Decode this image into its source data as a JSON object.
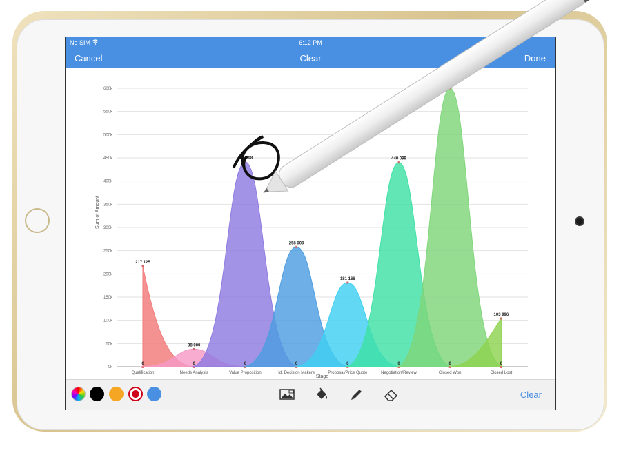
{
  "status": {
    "carrier": "No SIM",
    "time": "6:12 PM"
  },
  "nav": {
    "left_label": "Cancel",
    "center_label": "Clear",
    "right_label": "Done"
  },
  "toolbar": {
    "colors": [
      "#ff0000",
      "#000000",
      "#f5a623",
      "#d0021b",
      "#4a90e2"
    ],
    "tools": [
      "image-icon",
      "fill-bucket-icon",
      "pen-icon",
      "eraser-icon"
    ],
    "clear_label": "Clear"
  },
  "chart_data": {
    "type": "area",
    "xlabel": "Stage",
    "ylabel": "Sum of Amount",
    "categories": [
      "Qualification",
      "Needs Analysis",
      "Value Proposition",
      "Id. Decision Makers",
      "Proposal/Price Quote",
      "Negotiation/Review",
      "Closed Won",
      "Closed Lost"
    ],
    "values": [
      217125,
      38000,
      441198,
      258000,
      181166,
      440099,
      600000,
      103996
    ],
    "value_labels": [
      "217 125",
      "38 000",
      "441 198",
      "258 000",
      "181 166",
      "440 099",
      "60",
      "103 996"
    ],
    "zero_label": "0",
    "colors": [
      "#f27a7a",
      "#f59ac6",
      "#8f7be0",
      "#4d9ee0",
      "#3fd0f2",
      "#3fe0a6",
      "#7fd67a",
      "#8ed34f"
    ],
    "yticks": [
      "0k",
      "50k",
      "100k",
      "150k",
      "200k",
      "250k",
      "300k",
      "350k",
      "400k",
      "450k",
      "500k",
      "550k",
      "600k"
    ],
    "ylim": [
      0,
      600000
    ],
    "grid": true
  }
}
